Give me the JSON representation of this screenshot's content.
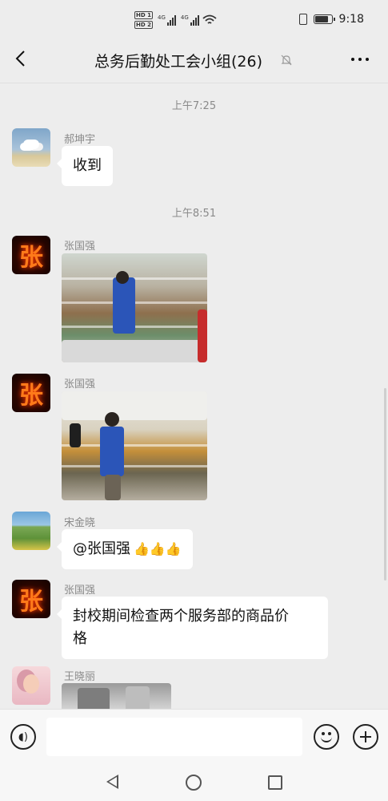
{
  "status_bar": {
    "hd_badges": [
      "HD 1",
      "HD 2"
    ],
    "network": [
      "4G",
      "4G"
    ],
    "time": "9:18"
  },
  "header": {
    "title": "总务后勤处工会小组(26)",
    "icons": [
      "back-arrow-icon",
      "mute-bell-icon",
      "more-icon"
    ]
  },
  "messages": {
    "t1": "上午7:25",
    "m1": {
      "sender": "郝坤宇",
      "text": "收到"
    },
    "t2": "上午8:51",
    "m2": {
      "sender": "张国强",
      "type": "image"
    },
    "m3": {
      "sender": "张国强",
      "type": "image"
    },
    "m4": {
      "sender": "宋金晓",
      "text": "@张国强",
      "emoji": "👍👍👍"
    },
    "m5": {
      "sender": "张国强",
      "text_line1": "封校期间检查两个服务部的商品价",
      "text_line2": "格"
    },
    "m6": {
      "sender": "王晓丽",
      "type": "image"
    }
  },
  "avatar_glyph": "张",
  "input_bar": {
    "placeholder": "",
    "icons": [
      "voice-icon",
      "emoji-icon",
      "plus-icon"
    ]
  },
  "system_nav": {
    "icons": [
      "back-triangle-icon",
      "home-circle-icon",
      "recents-square-icon"
    ]
  }
}
